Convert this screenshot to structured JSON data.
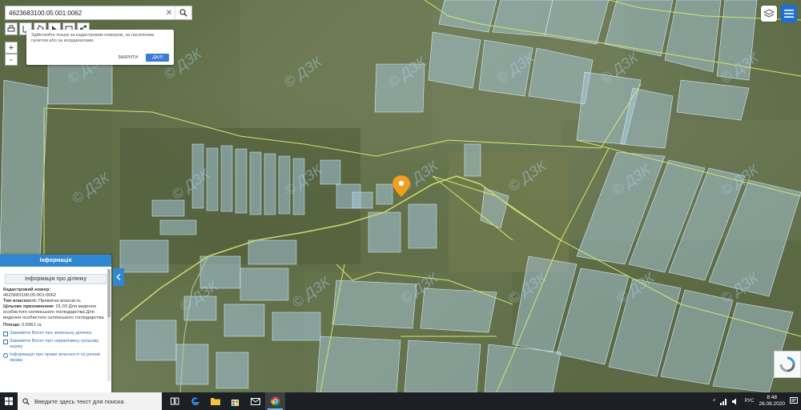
{
  "search": {
    "value": "4623683100:05:001:0062"
  },
  "tooltip": {
    "text": "Здійснюйте пошук за кадастровим номером, за населеним пунктом або за координатами.",
    "close_label": "ЗАКРИТИ",
    "next_label": "ДАЛІ"
  },
  "zoom": {
    "in": "+",
    "out": "-"
  },
  "watermark": "© ДЗК",
  "panel": {
    "title": "Інформація",
    "subtitle": "Інформація про ділянку",
    "cadastre_label": "Кадастровий номер:",
    "cadastre_value": "4623683100:05:001:0062",
    "ownership_label": "Тип власності:",
    "ownership_value": "Приватна власність",
    "purpose_label": "Цільове призначення:",
    "purpose_value": "01.03 Для ведення особистого селянського господарства Для ведення особистого селянського господарства",
    "area_label": "Площа:",
    "area_value": "0.5961 га",
    "link1": "Замовити Витяг про земельну ділянку",
    "link2": "Замовити Витяг про нормативну грошову оцінку",
    "link3": "Інформація про право власності та речові права"
  },
  "taskbar": {
    "search_placeholder": "Введите здесь текст для поиска",
    "lang": "РУС",
    "time": "8:48",
    "date": "26.08.2020"
  },
  "colors": {
    "accent": "#2f86d1",
    "parcel_line": "#cfe86a",
    "marker": "#f0a020"
  }
}
